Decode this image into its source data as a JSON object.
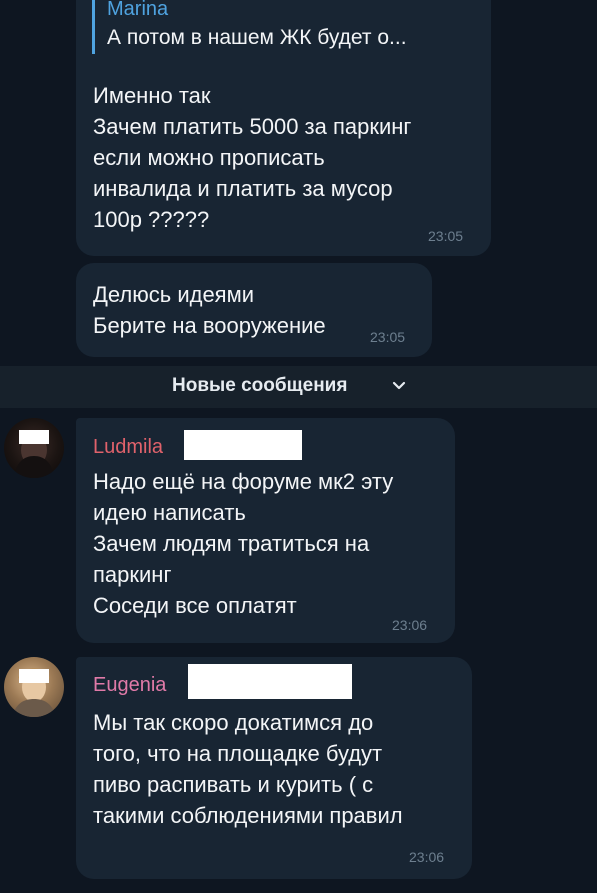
{
  "messages": [
    {
      "reply": {
        "name": "Marina",
        "text": "А потом в нашем ЖК будет о..."
      },
      "text": "Именно так\nЗачем платить 5000 за паркинг\nесли можно прописать\nинвалида и платить за мусор\n100р ?????",
      "time": "23:05"
    },
    {
      "text": "Делюсь идеями\nБерите на вооружение",
      "time": "23:05"
    },
    {
      "sender": "Ludmila",
      "text": "Надо ещё на форуме мк2 эту\nидею написать\nЗачем людям тратиться на\nпаркинг\nСоседи все оплатят",
      "time": "23:06"
    },
    {
      "sender": "Eugenia",
      "text": "Мы так скоро докатимся до\nтого, что на площадке будут\nпиво распивать и курить ( с\nтакими соблюдениями правил",
      "time": "23:06"
    }
  ],
  "divider": {
    "label": "Новые сообщения"
  },
  "colors": {
    "background": "#0e1621",
    "bubble": "#182533",
    "reply_accent": "#4fa3e0",
    "ludmila_name": "#e0626b",
    "eugenia_name": "#e07aa8",
    "time": "#6d7f8f"
  },
  "icons": {
    "divider_chevron": "chevron-down-icon"
  }
}
